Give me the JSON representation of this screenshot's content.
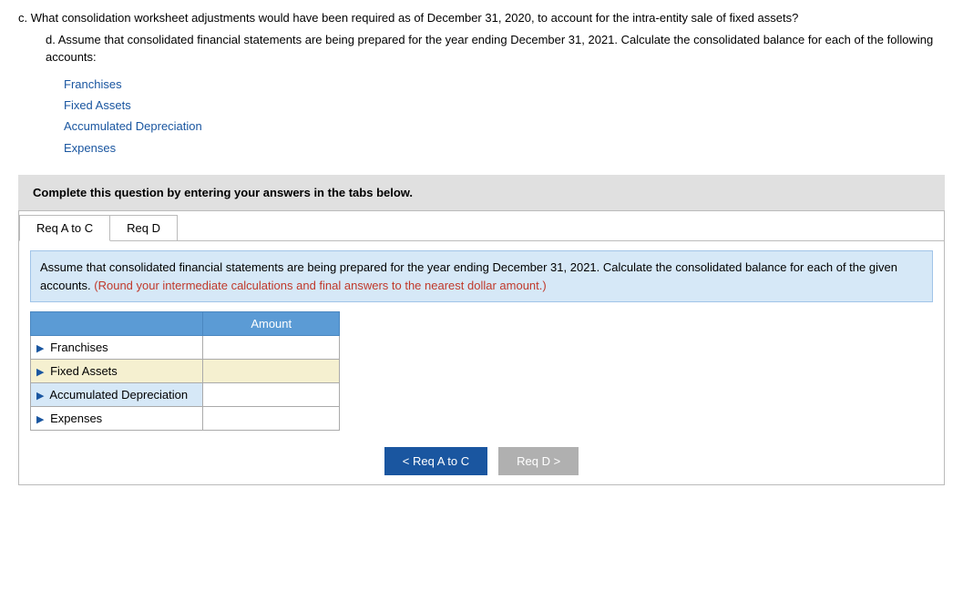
{
  "questions": {
    "c": {
      "label": "c.",
      "text": "What consolidation worksheet adjustments would have been required as of December 31, 2020, to account for the intra-entity sale of fixed assets?"
    },
    "d": {
      "label": "d.",
      "text_part1": "Assume that consolidated financial statements are being prepared for the year ending December 31, 2021. Calculate the consolidated balance for each of the following accounts:"
    }
  },
  "link_items": [
    "Franchises",
    "Fixed Assets",
    "Accumulated Depreciation",
    "Expenses"
  ],
  "banner": {
    "text": "Complete this question by entering your answers in the tabs below."
  },
  "tabs": [
    {
      "label": "Req A to C",
      "active": true
    },
    {
      "label": "Req D",
      "active": false
    }
  ],
  "instruction": {
    "text": "Assume that consolidated financial statements are being prepared for the year ending December 31, 2021. Calculate the consolidated balance for each of the given accounts. ",
    "red_text": "(Round your intermediate calculations and final answers to the nearest dollar amount.)"
  },
  "table": {
    "header": "Amount",
    "rows": [
      {
        "label": "Franchises",
        "value": "",
        "row_class": ""
      },
      {
        "label": "Fixed Assets",
        "value": "",
        "row_class": "highlighted-row"
      },
      {
        "label": "Accumulated Depreciation",
        "value": "",
        "row_class": "blue-row"
      },
      {
        "label": "Expenses",
        "value": "",
        "row_class": ""
      }
    ]
  },
  "buttons": {
    "prev_label": "< Req A to C",
    "next_label": "Req D >"
  }
}
